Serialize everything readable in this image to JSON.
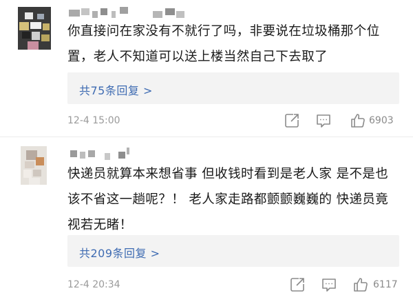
{
  "comments": [
    {
      "text": "你直接问在家没有不就行了吗，非要说在垃圾桶那个位置，老人不知道可以送上楼当然自己下去取了",
      "reply_link": "共75条回复 >",
      "timestamp": "12-4 15:00",
      "like_count": "6903",
      "icons": {
        "share": "share-square-arrow-icon",
        "comment": "comment-bubble-icon",
        "like": "thumbs-up-icon"
      }
    },
    {
      "text": "快递员就算本来想省事 但收钱时看到是老人家 是不是也该不省这一趟呢？！ 老人家走路都颤颤巍巍的 快递员竟视若无睹！",
      "reply_link": "共209条回复 >",
      "timestamp": "12-4 20:34",
      "like_count": "6117",
      "icons": {
        "share": "share-square-arrow-icon",
        "comment": "comment-bubble-icon",
        "like": "thumbs-up-icon"
      }
    }
  ],
  "colors": {
    "link_blue": "#3e6bb2",
    "reply_bg": "#f3f3f3",
    "meta_gray": "#9a9a9a"
  }
}
